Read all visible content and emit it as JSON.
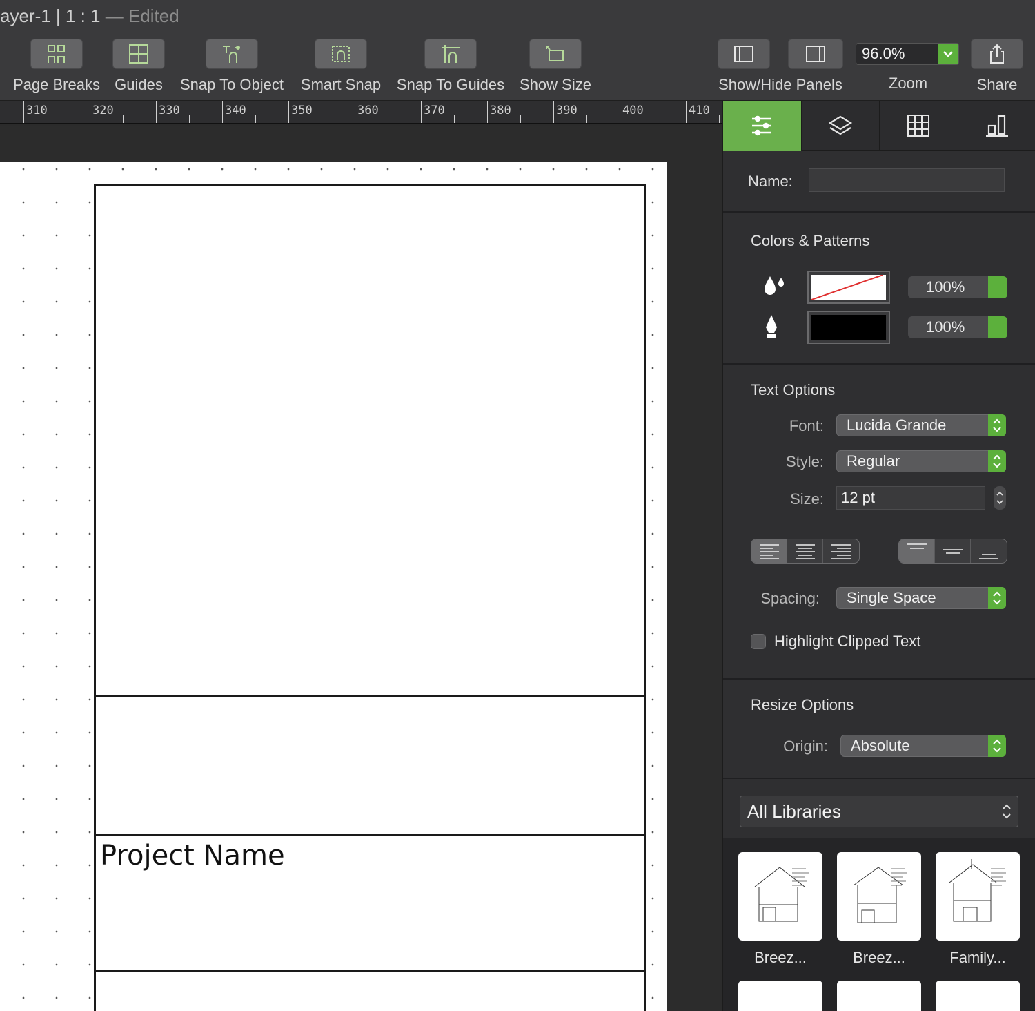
{
  "window": {
    "title": "ayer-1 | 1 : 1",
    "edited": "— Edited"
  },
  "toolbar": {
    "page_breaks": "Page Breaks",
    "guides": "Guides",
    "snap_to_object": "Snap To Object",
    "smart_snap": "Smart Snap",
    "snap_to_guides": "Snap To Guides",
    "show_size": "Show Size",
    "show_hide_panels": "Show/Hide Panels",
    "zoom_label": "Zoom",
    "zoom_value": "96.0%",
    "share": "Share"
  },
  "ruler": {
    "labels": [
      "310",
      "320",
      "330",
      "340",
      "350",
      "360",
      "370",
      "380",
      "390",
      "400",
      "410"
    ]
  },
  "canvas": {
    "project_name": "Project Name"
  },
  "panel": {
    "name_label": "Name:",
    "name_value": "",
    "colors": {
      "title": "Colors & Patterns",
      "fill_opacity": "100%",
      "stroke_opacity": "100%",
      "fill_color": "#ffffff",
      "stroke_color": "#000000"
    },
    "text": {
      "title": "Text Options",
      "font_label": "Font:",
      "font_value": "Lucida Grande",
      "style_label": "Style:",
      "style_value": "Regular",
      "size_label": "Size:",
      "size_value": "12 pt",
      "spacing_label": "Spacing:",
      "spacing_value": "Single Space",
      "highlight_label": "Highlight Clipped Text"
    },
    "resize": {
      "title": "Resize Options",
      "origin_label": "Origin:",
      "origin_value": "Absolute"
    },
    "library": {
      "selected": "All Libraries",
      "items": [
        "Breez...",
        "Breez...",
        "Family..."
      ]
    }
  },
  "colors": {
    "accent": "#6ab04c",
    "toolbar": "#3a3a3c",
    "panel": "#2f2f31"
  }
}
